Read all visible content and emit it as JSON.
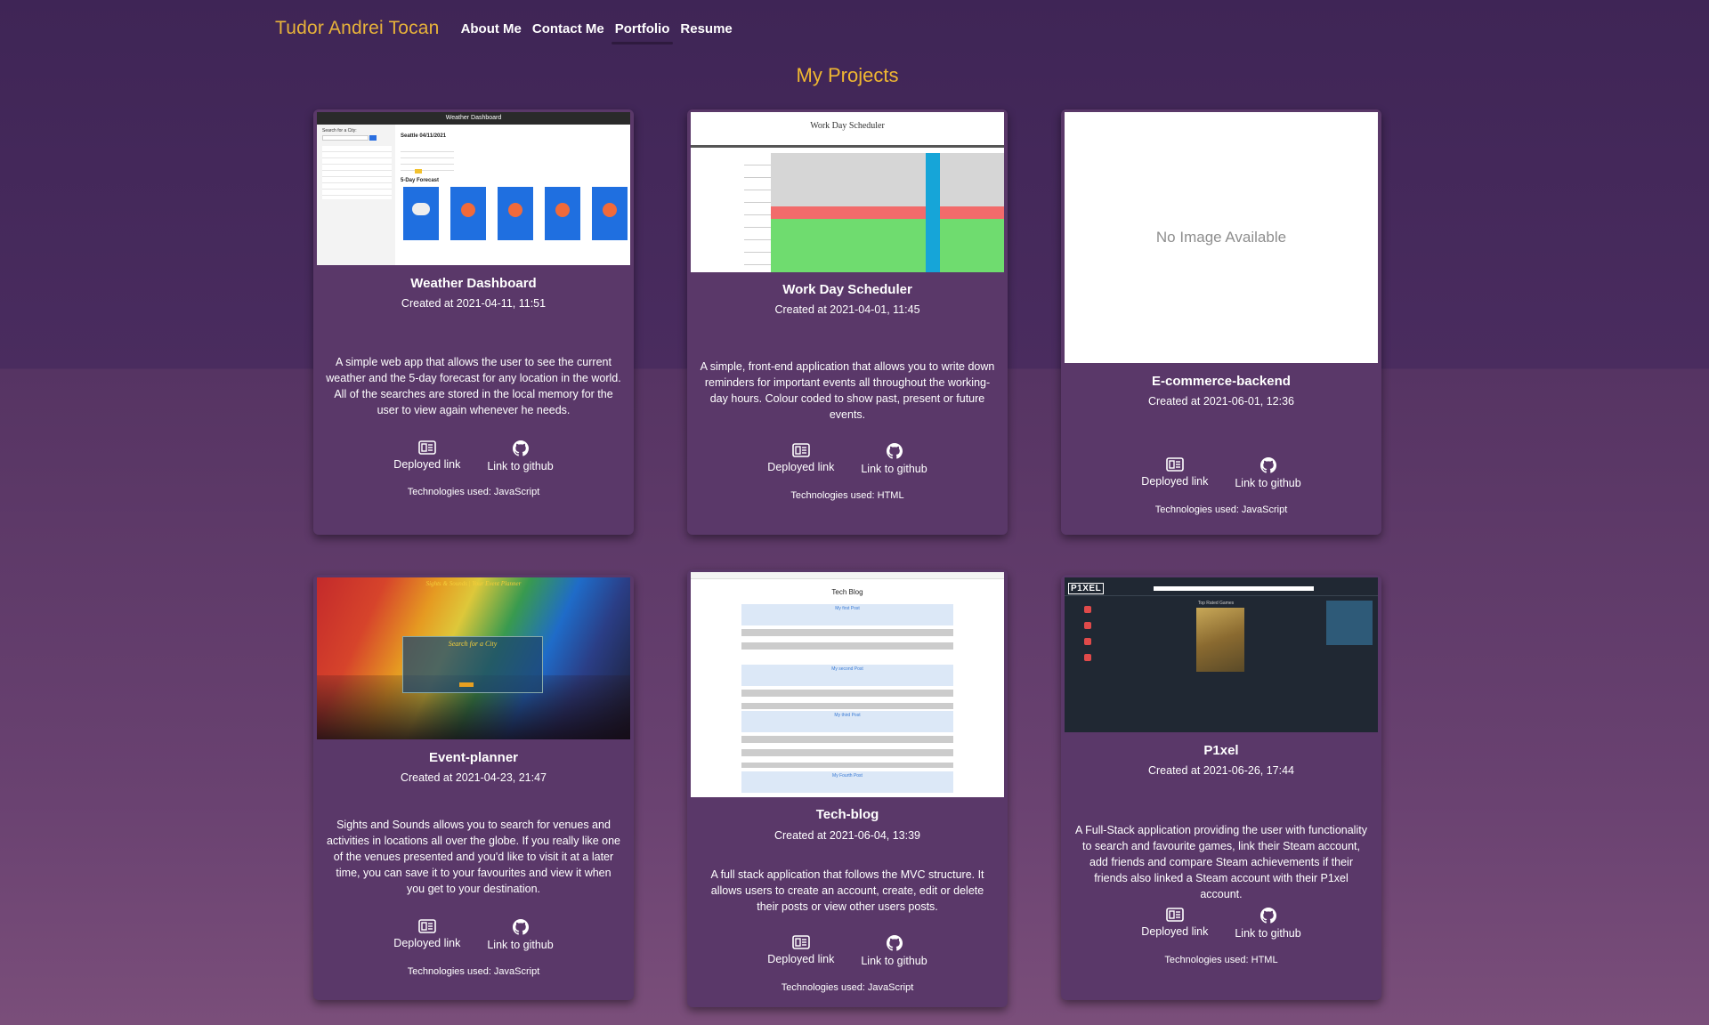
{
  "nav": {
    "brand": "Tudor Andrei Tocan",
    "links": [
      {
        "label": "About Me"
      },
      {
        "label": "Contact Me"
      },
      {
        "label": "Portfolio"
      },
      {
        "label": "Resume"
      }
    ]
  },
  "heading": "My Projects",
  "common": {
    "deployed_label": "Deployed link",
    "github_label": "Link to github"
  },
  "projects": [
    {
      "title": "Weather Dashboard",
      "date": "Created at 2021-04-11, 11:51",
      "description": "A simple web app that allows the user to see the current weather and the 5-day forecast for any location in the world. All of the searches are stored in the local memory for the user to view again whenever he needs.",
      "tech": "Technologies used: JavaScript",
      "thumb": {
        "header": "Weather Dashboard",
        "city": "Seattle 04/11/2021",
        "forecast_label": "5-Day Forecast",
        "search_label": "Search for a City:"
      }
    },
    {
      "title": "Work Day Scheduler",
      "date": "Created at 2021-04-01, 11:45",
      "description": "A simple, front-end application that allows you to write down reminders for important events all throughout the working-day hours. Colour coded to show past, present or future events.",
      "tech": "Technologies used: HTML",
      "thumb": {
        "header": "Work Day Scheduler"
      }
    },
    {
      "title": "E-commerce-backend",
      "date": "Created at 2021-06-01, 12:36",
      "description": "",
      "tech": "Technologies used: JavaScript",
      "thumb": {
        "placeholder": "No Image Available"
      }
    },
    {
      "title": "Event-planner",
      "date": "Created at 2021-04-23, 21:47",
      "description": "Sights and Sounds allows you to search for venues and activities in locations all over the globe. If you really like one of the venues presented and you'd like to visit it at a later time, you can save it to your favourites and view it when you get to your destination.",
      "tech": "Technologies used: JavaScript",
      "thumb": {
        "header": "Sights & Sounds | Your Event Planner",
        "search_label": "Search for a City"
      }
    },
    {
      "title": "Tech-blog",
      "date": "Created at 2021-06-04, 13:39",
      "description": "A full stack application that follows the MVC structure. It allows users to create an account, create, edit or delete their posts or view other users posts.",
      "tech": "Technologies used: JavaScript",
      "thumb": {
        "header": "Tech Blog",
        "posts": [
          "My first Post",
          "My second Post",
          "My third Post",
          "My Fourth Post"
        ]
      }
    },
    {
      "title": "P1xel",
      "date": "Created at 2021-06-26, 17:44",
      "description": "A Full-Stack application providing the user with functionality to search and favourite games, link their Steam account, add friends and compare Steam achievements if their friends also linked a Steam account with their P1xel account.",
      "tech": "Technologies used: HTML",
      "thumb": {
        "logo": "P1XEL",
        "section": "Top Rated Games"
      }
    }
  ]
}
